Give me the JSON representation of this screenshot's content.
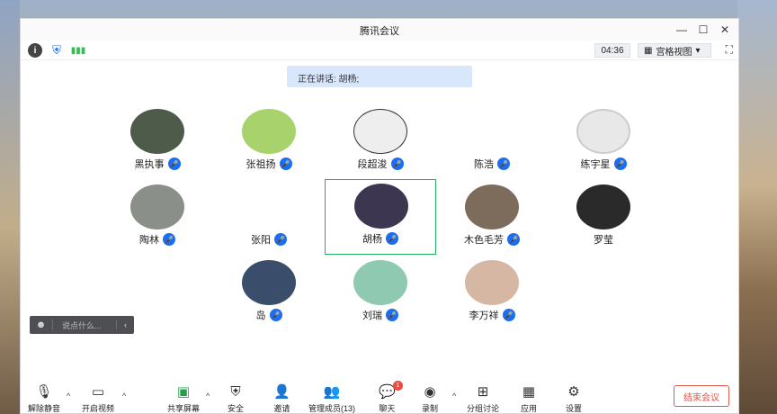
{
  "window": {
    "title": "腾讯会议"
  },
  "window_controls": {
    "minimize": "—",
    "maximize": "☐",
    "close": "✕"
  },
  "infobar": {
    "timer": "04:36",
    "grid_view": "宫格视图",
    "fullscreen": "⛶"
  },
  "speaking": {
    "text": "正在讲话: 胡杨;"
  },
  "participants": [
    {
      "name": "黑执事",
      "avatar_color": "#4e5b4b"
    },
    {
      "name": "张祖扬",
      "avatar_color": "#a8d36c"
    },
    {
      "name": "段超浚",
      "avatar_color": "#eeeeee"
    },
    {
      "name": "陈浩",
      "avatar_color": "#ffffff"
    },
    {
      "name": "练宇星",
      "avatar_color": "#e8e8e8"
    },
    {
      "name": "陶林",
      "avatar_color": "#8a8f8a"
    },
    {
      "name": "张阳",
      "avatar_color": "#ffffff"
    },
    {
      "name": "胡杨",
      "avatar_color": "#3d3650"
    },
    {
      "name": "木色毛芳",
      "avatar_color": "#7d6b5c"
    },
    {
      "name": "罗莹",
      "avatar_color": "#2a2a2a"
    },
    {
      "name": "岛",
      "avatar_color": "#3a4d6b"
    },
    {
      "name": "刘瑞",
      "avatar_color": "#8fc9b2"
    },
    {
      "name": "李万祥",
      "avatar_color": "#d6b7a3"
    }
  ],
  "chat": {
    "placeholder": "说点什么..."
  },
  "toolbar": {
    "unmute": "解除静音",
    "start_video": "开启视频",
    "share_screen": "共享屏幕",
    "security": "安全",
    "invite": "邀请",
    "manage_members": "管理成员(13)",
    "chat": "聊天",
    "chat_badge": "1",
    "record": "录制",
    "breakout": "分组讨论",
    "apps": "应用",
    "settings": "设置",
    "end_meeting": "结束会议"
  },
  "colors": {
    "accent": "#1b6ef3",
    "active_border": "#20b15a",
    "end": "#e2554a"
  }
}
